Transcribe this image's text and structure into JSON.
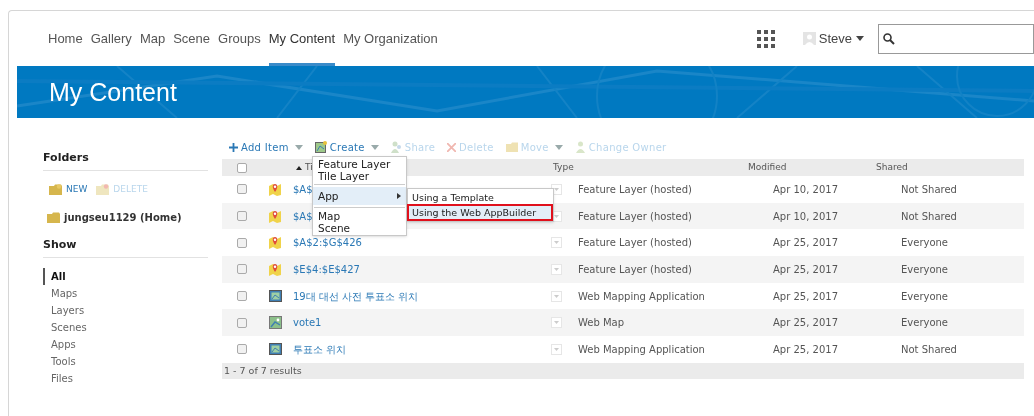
{
  "nav": {
    "items": [
      {
        "label": "Home",
        "selected": false
      },
      {
        "label": "Gallery",
        "selected": false
      },
      {
        "label": "Map",
        "selected": false
      },
      {
        "label": "Scene",
        "selected": false
      },
      {
        "label": "Groups",
        "selected": false
      },
      {
        "label": "My Content",
        "selected": true
      },
      {
        "label": "My Organization",
        "selected": false
      }
    ],
    "user": "Steve"
  },
  "banner": {
    "title": "My Content"
  },
  "sidebar": {
    "folders_heading": "Folders",
    "folder_actions": [
      {
        "label": "NEW",
        "disabled": false
      },
      {
        "label": "DELETE",
        "disabled": true
      }
    ],
    "folders": [
      {
        "label": "jungseu1129 (Home)"
      }
    ],
    "show_heading": "Show",
    "filters": [
      {
        "label": "All",
        "selected": true
      },
      {
        "label": "Maps",
        "selected": false
      },
      {
        "label": "Layers",
        "selected": false
      },
      {
        "label": "Scenes",
        "selected": false
      },
      {
        "label": "Apps",
        "selected": false
      },
      {
        "label": "Tools",
        "selected": false
      },
      {
        "label": "Files",
        "selected": false
      }
    ]
  },
  "toolbar": [
    {
      "kind": "add",
      "label": "Add Item",
      "disabled": false
    },
    {
      "kind": "create",
      "label": "Create",
      "disabled": false
    },
    {
      "kind": "share",
      "label": "Share",
      "disabled": true
    },
    {
      "kind": "delete",
      "label": "Delete",
      "disabled": true
    },
    {
      "kind": "move",
      "label": "Move",
      "disabled": true
    },
    {
      "kind": "owner",
      "label": "Change Owner",
      "disabled": true
    }
  ],
  "table": {
    "all_checked": false,
    "columns": [
      "Ti",
      "Type",
      "Modified",
      "Shared"
    ],
    "rows": [
      {
        "kind": "layer",
        "title": "$A$",
        "type": "Feature Layer (hosted)",
        "modified": "Apr 10, 2017",
        "shared": "Not Shared",
        "checked": false
      },
      {
        "kind": "layer",
        "title": "$A$",
        "type": "Feature Layer (hosted)",
        "modified": "Apr 10, 2017",
        "shared": "Not Shared",
        "checked": false
      },
      {
        "kind": "layer",
        "title": "$A$2:$G$426",
        "type": "Feature Layer (hosted)",
        "modified": "Apr 25, 2017",
        "shared": "Everyone",
        "checked": false
      },
      {
        "kind": "layer",
        "title": "$E$4:$E$427",
        "type": "Feature Layer (hosted)",
        "modified": "Apr 25, 2017",
        "shared": "Everyone",
        "checked": false
      },
      {
        "kind": "app",
        "title": "19대 대선 사전 투표소 위치",
        "type": "Web Mapping Application",
        "modified": "Apr 25, 2017",
        "shared": "Everyone",
        "checked": false
      },
      {
        "kind": "map",
        "title": "vote1",
        "type": "Web Map",
        "modified": "Apr 25, 2017",
        "shared": "Everyone",
        "checked": false
      },
      {
        "kind": "app",
        "title": "투표소 위치",
        "type": "Web Mapping Application",
        "modified": "Apr 25, 2017",
        "shared": "Not Shared",
        "checked": false
      }
    ],
    "footer": "1 - 7 of 7 results"
  },
  "create_menu": {
    "groups": [
      [
        {
          "label": "Feature Layer",
          "selected": false,
          "submenu": false
        },
        {
          "label": "Tile Layer",
          "selected": false,
          "submenu": false
        }
      ],
      [
        {
          "label": "App",
          "selected": true,
          "submenu": true
        }
      ],
      [
        {
          "label": "Map",
          "selected": false,
          "submenu": false
        },
        {
          "label": "Scene",
          "selected": false,
          "submenu": false
        }
      ]
    ],
    "submenu": [
      {
        "label": "Using a Template",
        "highlighted": false
      },
      {
        "label": "Using the Web AppBuilder",
        "highlighted": true
      }
    ]
  }
}
